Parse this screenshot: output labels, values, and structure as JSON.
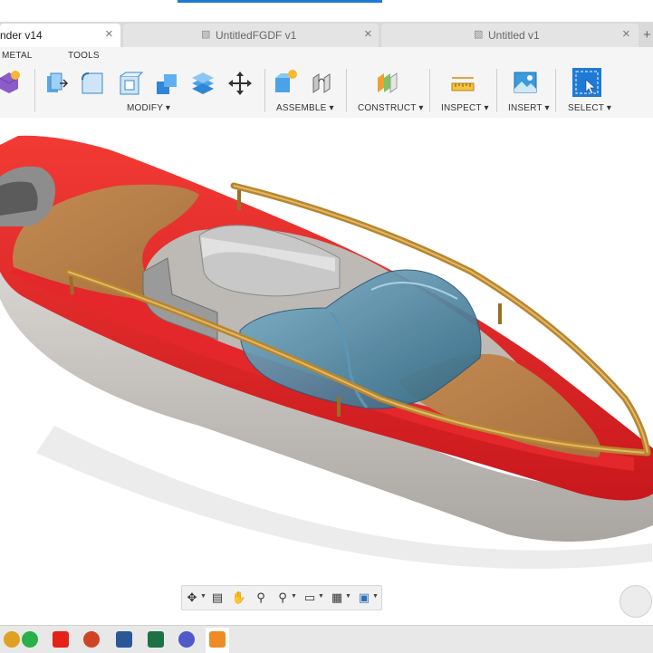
{
  "tabs": [
    {
      "label": "nder v14",
      "active": true
    },
    {
      "label": "UntitledFGDF v1",
      "active": false
    },
    {
      "label": "Untitled v1",
      "active": false
    }
  ],
  "tab_close_glyph": "×",
  "tab_add_glyph": "+",
  "toolbar": {
    "top_labels": {
      "sheet_metal": "METAL",
      "tools": "TOOLS"
    },
    "groups": [
      {
        "label": "MODIFY ▾"
      },
      {
        "label": "ASSEMBLE ▾"
      },
      {
        "label": "CONSTRUCT ▾"
      },
      {
        "label": "INSPECT ▾"
      },
      {
        "label": "INSERT ▾"
      },
      {
        "label": "SELECT ▾"
      }
    ]
  },
  "colors": {
    "hull_red": "#e8252a",
    "hull_gray": "#c9c6c2",
    "deck_wood": "#c8935c",
    "rail_brass": "#b8862e",
    "canopy_blue": "#3f7f9e",
    "accent_blue": "#1f7ad6"
  },
  "navbar_icons": [
    "orbit-icon",
    "look-at-icon",
    "pan-icon",
    "zoom-window-icon",
    "zoom-icon",
    "display-settings-icon",
    "grid-icon",
    "viewports-icon"
  ],
  "taskbar_icons": [
    "chrome-icon",
    "whatsapp-icon",
    "youtube-icon",
    "powerpoint-icon",
    "word-icon",
    "excel-icon",
    "teams-icon",
    "fusion-icon"
  ]
}
